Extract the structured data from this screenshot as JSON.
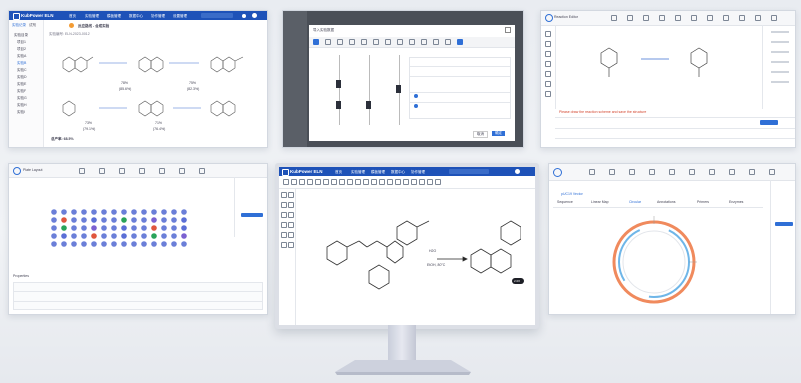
{
  "app": {
    "brand": "KubPower ELN",
    "brand_sub": "PRO",
    "nav": [
      "首页",
      "实验管理",
      "模板管理",
      "数据中心",
      "协作管理",
      "设置管理"
    ],
    "search_placeholder": "搜索"
  },
  "panel_eln": {
    "tabs": [
      "实验记录",
      "试剂"
    ],
    "sidebar_items": [
      "实验目录",
      "项目1",
      "项目2",
      "实验A",
      "实验B",
      "实验C",
      "实验D",
      "实验E",
      "实验F",
      "实验G",
      "实验H",
      "实验I"
    ],
    "title": "反应路线 - 合成实验",
    "subtitle": "实验编号: ELN-2023-0012",
    "footer_label": "总产率: 68.5%",
    "yields": [
      "78%",
      "(85.6%)",
      "75%",
      "(82.3%)",
      "73%",
      "(79.1%)",
      "71%",
      "(76.4%)"
    ]
  },
  "panel_dialog": {
    "title": "导入实验数据",
    "ok_label": "确定",
    "cancel_label": "取消"
  },
  "panel_draw": {
    "title": "Reaction Editor",
    "note": "Please draw the reaction scheme and save the structure"
  },
  "panel_array": {
    "title": "Plate Layout",
    "section": "Properties"
  },
  "panel_plasmid": {
    "title": "pUC19 Vector",
    "tabs": [
      "Sequence",
      "Linear Map",
      "Circular",
      "Annotations",
      "Primers",
      "Enzymes"
    ]
  },
  "monitor": {
    "brand": "KubPower ELN",
    "reagent_top": "H2O",
    "reagent_bottom": "EtOH, 80°C",
    "badge": "2.0X"
  },
  "colors": {
    "accent": "#1e52b8",
    "link": "#2f6fd6",
    "plasmid_orange": "#f08a5d",
    "plasmid_blue": "#6fb6e8"
  }
}
